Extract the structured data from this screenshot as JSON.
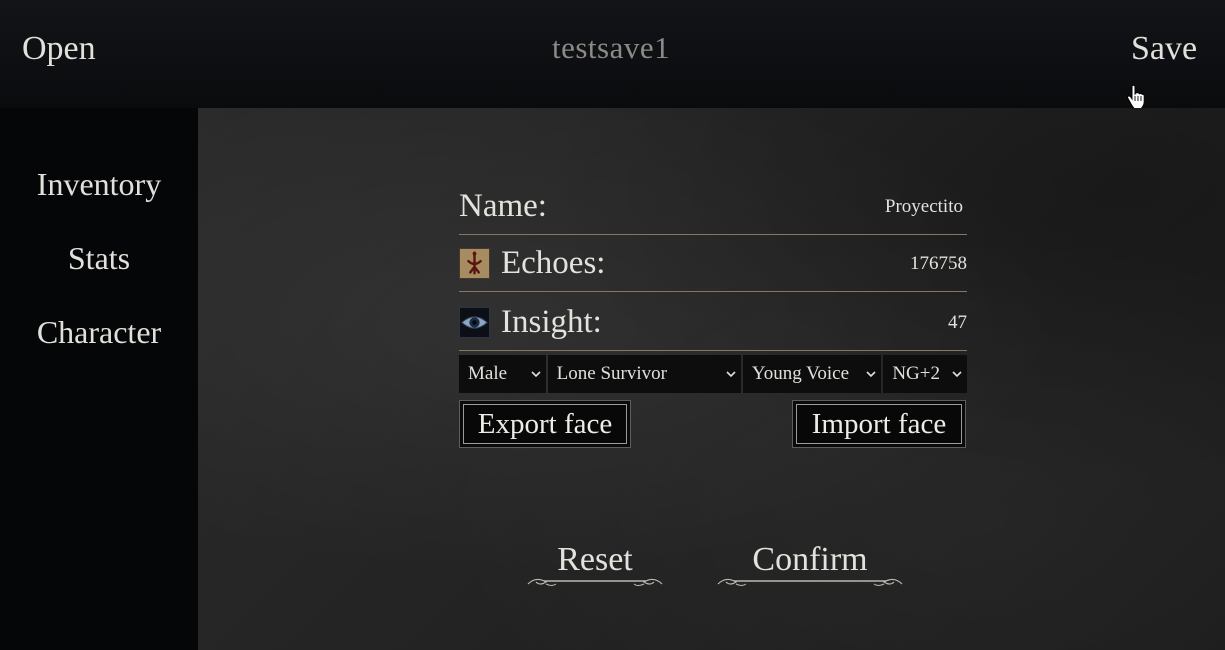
{
  "header": {
    "open_label": "Open",
    "title": "testsave1",
    "save_label": "Save"
  },
  "sidebar": {
    "items": [
      {
        "label": "Inventory"
      },
      {
        "label": "Stats"
      },
      {
        "label": "Character"
      }
    ]
  },
  "character": {
    "name_label": "Name:",
    "name_value": "Proyectito",
    "echoes_label": "Echoes:",
    "echoes_value": "176758",
    "echoes_icon": "blood-echoes-icon",
    "insight_label": "Insight:",
    "insight_value": "47",
    "insight_icon": "eye-icon"
  },
  "selects": {
    "gender": "Male",
    "origin": "Lone Survivor",
    "voice": "Young Voice",
    "ng": "NG+2"
  },
  "face": {
    "export_label": "Export face",
    "import_label": "Import face"
  },
  "actions": {
    "reset_label": "Reset",
    "confirm_label": "Confirm"
  },
  "colors": {
    "background": "#050608",
    "panel": "#262626",
    "divider": "#857860",
    "text": "#e2e0da",
    "title_muted": "#8b8a86"
  }
}
